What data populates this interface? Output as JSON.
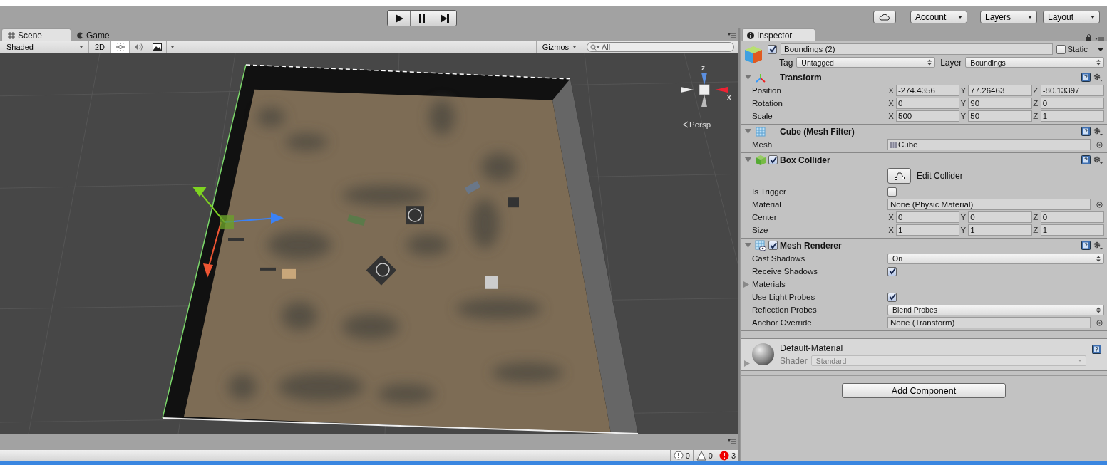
{
  "toolbar": {
    "play_buttons": [
      {
        "kind": "play"
      },
      {
        "kind": "pause"
      },
      {
        "kind": "step"
      }
    ],
    "account": "Account",
    "layers": "Layers",
    "layout": "Layout"
  },
  "scene_tabs": [
    {
      "label": "Scene",
      "kind": "scene",
      "selected": true
    },
    {
      "label": "Game",
      "kind": "game",
      "selected": false
    }
  ],
  "scene_toolbar": {
    "draw_mode": "Shaded",
    "mode_2d": {
      "label": "2D",
      "on": false
    },
    "toggles": [
      {
        "kind": "light",
        "on": true
      },
      {
        "kind": "audio",
        "on": false
      },
      {
        "kind": "effects",
        "on": false
      }
    ],
    "gizmos": "Gizmos",
    "search": {
      "placeholder": "All"
    }
  },
  "scene_gizmo": {
    "axis_labels": [
      "z",
      "x"
    ],
    "projection": "Persp"
  },
  "inspector": {
    "tab": "Inspector",
    "object": {
      "active": true,
      "name": "Boundings (2)",
      "static_label": "Static",
      "static": false,
      "tag_label": "Tag",
      "tag": "Untagged",
      "layer_label": "Layer",
      "layer": "Boundings"
    },
    "components": [
      {
        "title": "Transform",
        "kind": "transform",
        "expanded": true,
        "rows": [
          {
            "kind": "vector3",
            "label": "Position",
            "values": [
              {
                "axis": "X",
                "value": "-274.4356"
              },
              {
                "axis": "Y",
                "value": "77.26463"
              },
              {
                "axis": "Z",
                "value": "-80.13397"
              }
            ]
          },
          {
            "kind": "vector3",
            "label": "Rotation",
            "values": [
              {
                "axis": "X",
                "value": "0"
              },
              {
                "axis": "Y",
                "value": "90"
              },
              {
                "axis": "Z",
                "value": "0"
              }
            ]
          },
          {
            "kind": "vector3",
            "label": "Scale",
            "values": [
              {
                "axis": "X",
                "value": "500"
              },
              {
                "axis": "Y",
                "value": "50"
              },
              {
                "axis": "Z",
                "value": "1"
              }
            ]
          }
        ]
      },
      {
        "title": "Cube (Mesh Filter)",
        "kind": "mesh_filter",
        "expanded": true,
        "rows": [
          {
            "kind": "object",
            "label": "Mesh",
            "value": "Cube",
            "asset_icon": true
          }
        ]
      },
      {
        "title": "Box Collider",
        "kind": "box_collider",
        "enabled": true,
        "expanded": true,
        "rows": [
          {
            "kind": "edit_button",
            "label": "Edit Collider"
          },
          {
            "kind": "checkbox",
            "label": "Is Trigger",
            "checked": false
          },
          {
            "kind": "object",
            "label": "Material",
            "value": "None (Physic Material)",
            "asset_icon": false
          },
          {
            "kind": "vector3",
            "label": "Center",
            "values": [
              {
                "axis": "X",
                "value": "0"
              },
              {
                "axis": "Y",
                "value": "0"
              },
              {
                "axis": "Z",
                "value": "0"
              }
            ]
          },
          {
            "kind": "vector3",
            "label": "Size",
            "values": [
              {
                "axis": "X",
                "value": "1"
              },
              {
                "axis": "Y",
                "value": "1"
              },
              {
                "axis": "Z",
                "value": "1"
              }
            ]
          }
        ]
      },
      {
        "title": "Mesh Renderer",
        "kind": "mesh_renderer",
        "enabled": true,
        "expanded": true,
        "rows": [
          {
            "kind": "dropdown",
            "label": "Cast Shadows",
            "value": "On"
          },
          {
            "kind": "checkbox",
            "label": "Receive Shadows",
            "checked": true
          },
          {
            "kind": "foldout",
            "label": "Materials",
            "expanded": false
          },
          {
            "kind": "checkbox",
            "label": "Use Light Probes",
            "checked": true
          },
          {
            "kind": "dropdown",
            "label": "Reflection Probes",
            "value": "Blend Probes"
          },
          {
            "kind": "object",
            "label": "Anchor Override",
            "value": "None (Transform)",
            "asset_icon": false
          }
        ]
      }
    ],
    "material": {
      "name": "Default-Material",
      "shader_label": "Shader",
      "shader": "Standard"
    },
    "add_component": "Add Component"
  },
  "console_counts": [
    {
      "kind": "info",
      "count": "0"
    },
    {
      "kind": "warning",
      "count": "0"
    },
    {
      "kind": "error",
      "count": "3"
    }
  ]
}
